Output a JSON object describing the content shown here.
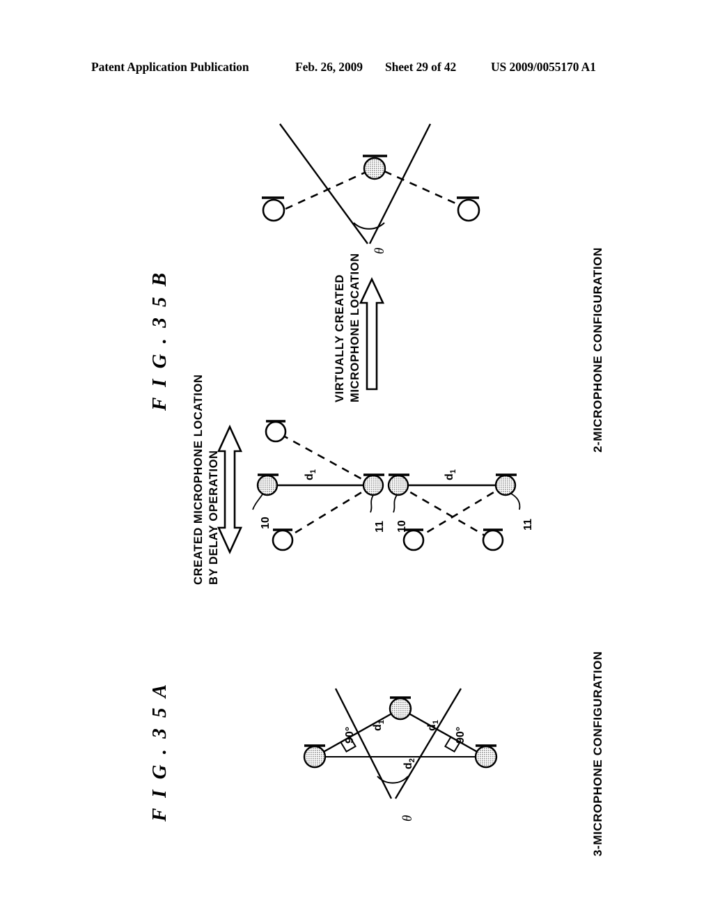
{
  "header": {
    "publication": "Patent Application Publication",
    "date": "Feb. 26, 2009",
    "sheet": "Sheet 29 of 42",
    "patent_number": "US 2009/0055170 A1"
  },
  "figures": [
    {
      "id": "fig-35b",
      "caption": "F I G .  3 5 B",
      "config_label": "2-MICROPHONE CONFIGURATION",
      "annotations": {
        "virtual_line1": "VIRTUALLY CREATED",
        "virtual_line2": "MICROPHONE LOCATION",
        "delay_line1": "CREATED MICROPHONE LOCATION",
        "delay_line2": "BY DELAY OPERATION",
        "theta": "θ",
        "distance_left": "d",
        "distance_left_sub": "1",
        "distance_right": "d",
        "distance_right_sub": "1",
        "ref_10_left": "10",
        "ref_11_left": "11",
        "ref_10_right": "10",
        "ref_11_right": "11"
      }
    },
    {
      "id": "fig-35a",
      "caption": "F I G .  3 5 A",
      "config_label": "3-MICROPHONE CONFIGURATION",
      "annotations": {
        "theta": "θ",
        "d1_left": "d",
        "d1_left_sub": "1",
        "d1_right": "d",
        "d1_right_sub": "1",
        "d2": "d",
        "d2_sub": "2",
        "angle_left": "90°",
        "angle_right": "90°"
      }
    }
  ],
  "colors": {
    "ink": "#000000",
    "paper": "#ffffff",
    "mic_hatch": "#9a9a9a"
  }
}
